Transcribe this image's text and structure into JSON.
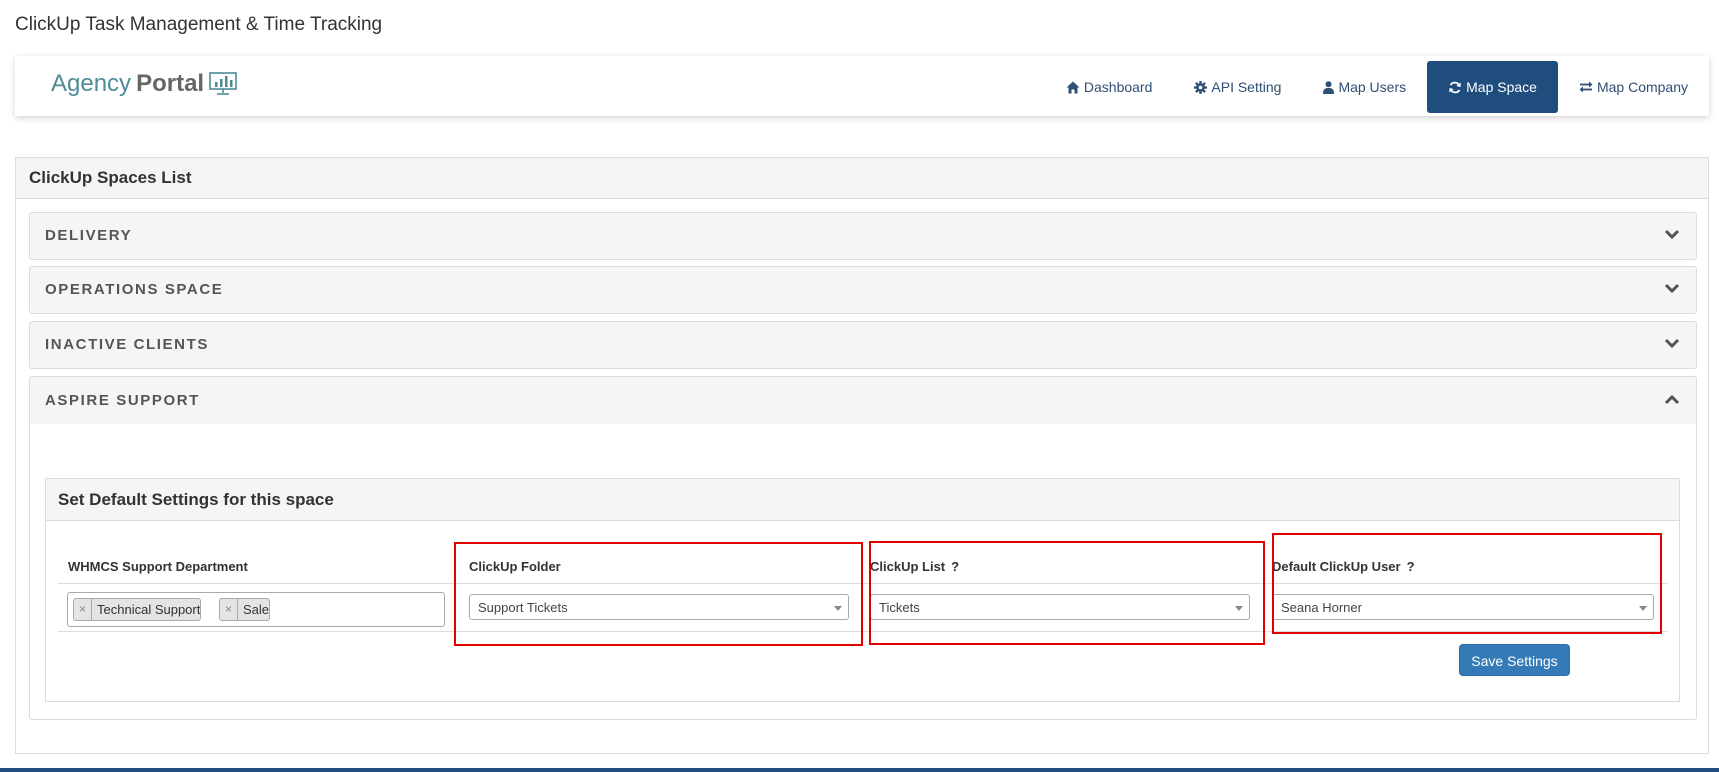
{
  "window": {
    "title": "ClickUp Task Management & Time Tracking"
  },
  "logo": {
    "text_light": "Agency",
    "text_bold": "Portal",
    "icon": "monitor-chart-icon"
  },
  "nav": {
    "items": [
      {
        "label": "Dashboard",
        "icon": "home-icon",
        "active": false
      },
      {
        "label": "API Setting",
        "icon": "gear-icon",
        "active": false
      },
      {
        "label": "Map Users",
        "icon": "user-icon",
        "active": false
      },
      {
        "label": "Map Space",
        "icon": "refresh-icon",
        "active": true
      },
      {
        "label": "Map Company",
        "icon": "exchange-icon",
        "active": false
      }
    ]
  },
  "spaces_panel": {
    "title": "ClickUp Spaces List",
    "spaces": [
      {
        "label": "DELIVERY",
        "expanded": false
      },
      {
        "label": "OPERATIONS SPACE",
        "expanded": false
      },
      {
        "label": "INACTIVE CLIENTS",
        "expanded": false
      },
      {
        "label": "ASPIRE SUPPORT",
        "expanded": true
      }
    ]
  },
  "settings": {
    "title": "Set Default Settings for this space",
    "columns": {
      "department": "WHMCS Support Department",
      "folder": "ClickUp Folder",
      "list": "ClickUp List",
      "user": "Default ClickUp User",
      "help_glyph": "?"
    },
    "department_tags": [
      "Technical Support",
      "Sale"
    ],
    "tag_remove_glyph": "×",
    "folder_value": "Support Tickets",
    "list_value": "Tickets",
    "user_value": "Seana Horner",
    "save_label": "Save Settings"
  },
  "colors": {
    "accent": "#1f4d7e",
    "nav_text": "#2f4f73",
    "button": "#337ab7",
    "highlight": "#e00000",
    "logo_teal": "#4d8c96"
  }
}
